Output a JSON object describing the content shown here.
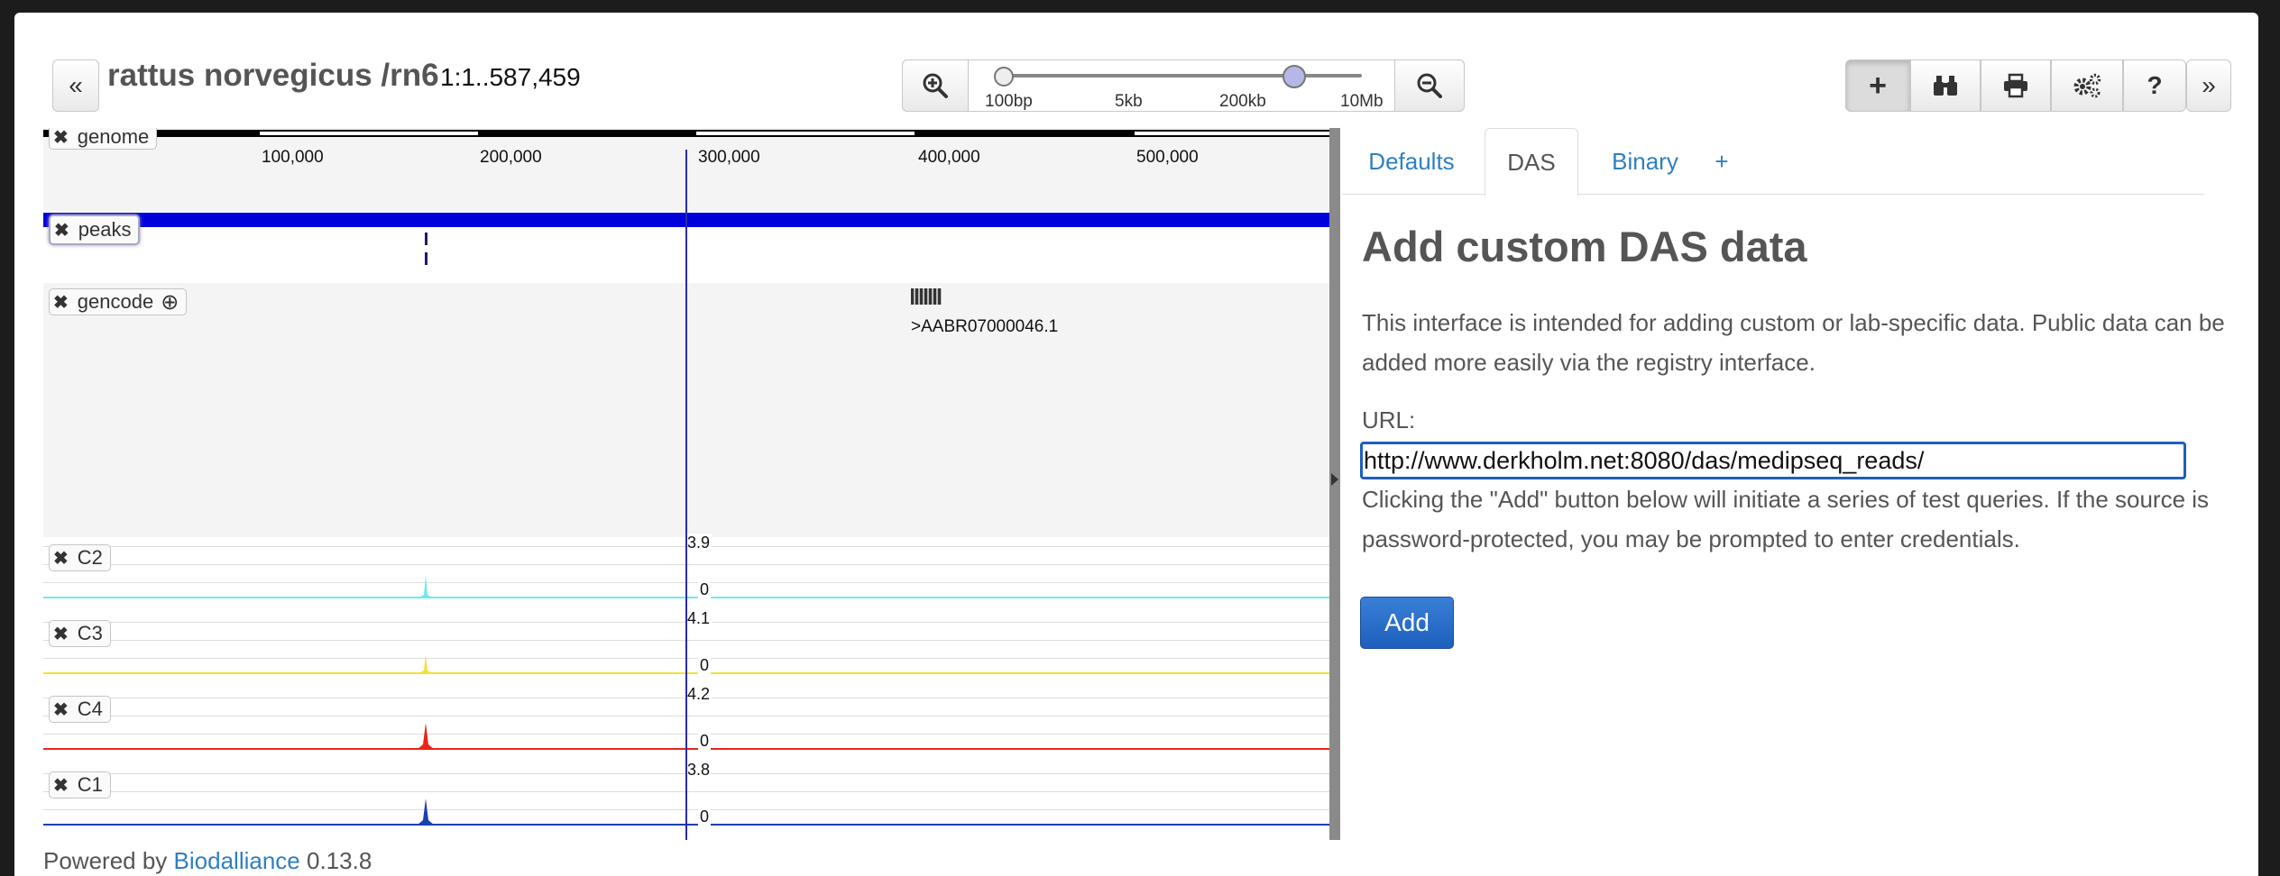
{
  "header": {
    "title": "rattus norvegicus /rn6",
    "coords": "1:1..587,459",
    "left_collapse_glyph": "«",
    "right_collapse_glyph": "»"
  },
  "zoom": {
    "labels": [
      "100bp",
      "5kb",
      "200kb",
      "10Mb"
    ],
    "zoom_in_icon": "zoom-in-icon",
    "zoom_out_icon": "zoom-out-icon"
  },
  "toolbar": {
    "buttons": [
      {
        "name": "add-track",
        "glyph": "+"
      },
      {
        "name": "binoculars",
        "glyph": "⚭"
      },
      {
        "name": "print",
        "glyph": "⎙"
      },
      {
        "name": "settings",
        "glyph": "⚙"
      },
      {
        "name": "help",
        "glyph": "?"
      }
    ]
  },
  "ruler": {
    "ticks": [
      "100,000",
      "200,000",
      "300,000",
      "400,000",
      "500,000"
    ]
  },
  "tracks": {
    "genome": "genome",
    "peaks": "peaks",
    "gencode": "gencode",
    "gene_label": ">AABR07000046.1",
    "signals": [
      {
        "name": "C2",
        "max": "3.9",
        "min": "0",
        "color": "#6fe8ee"
      },
      {
        "name": "C3",
        "max": "4.1",
        "min": "0",
        "color": "#f3e23a"
      },
      {
        "name": "C4",
        "max": "4.2",
        "min": "0",
        "color": "#e8241c"
      },
      {
        "name": "C1",
        "max": "3.8",
        "min": "0",
        "color": "#1b3fb0"
      }
    ],
    "remove_glyph": "✖",
    "add_glyph": "⊕"
  },
  "panel": {
    "tabs": [
      "Defaults",
      "DAS",
      "Binary",
      "+"
    ],
    "heading": "Add custom DAS data",
    "intro": "This interface is intended for adding custom or lab-specific data. Public data can be added more easily via the registry interface.",
    "url_label": "URL:",
    "url_value": "http://www.derkholm.net:8080/das/medipseq_reads/",
    "note": "Clicking the \"Add\" button below will initiate a series of test queries. If the source is password-protected, you may be prompted to enter credentials.",
    "add_label": "Add"
  },
  "footer": {
    "prefix": "Powered by",
    "link": "Biodalliance",
    "version": "0.13.8"
  },
  "colors": {
    "accent": "#2f7fc1",
    "peaks_bar": "#0000dd",
    "cursor": "#2a2aa8"
  }
}
